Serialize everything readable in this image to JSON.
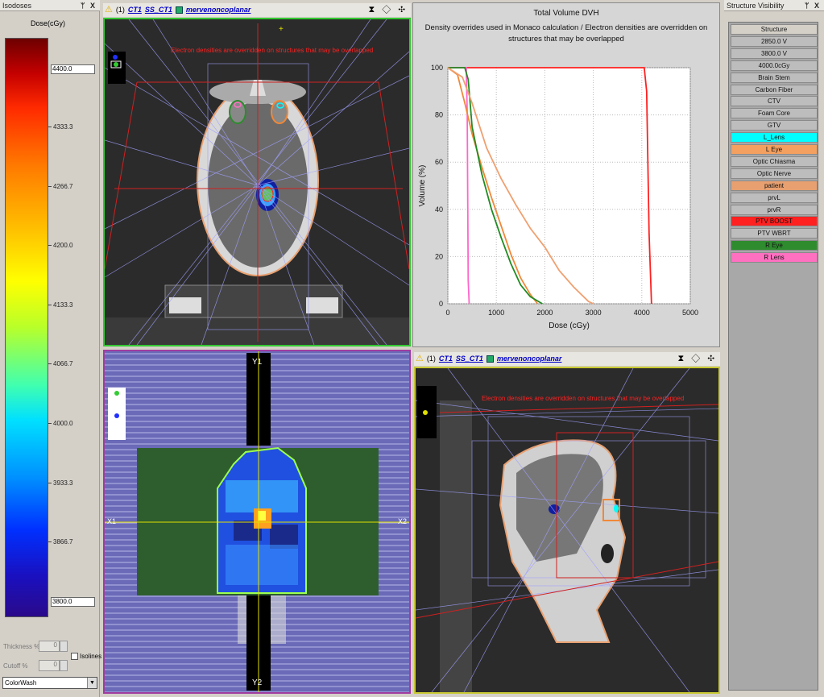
{
  "isodoses": {
    "title": "Isodoses",
    "pin": "ᛘ",
    "close": "X",
    "unit": "Dose(cGy)",
    "max_value": "4400.0",
    "min_value": "3800.0",
    "labels": [
      "4333.3",
      "4266.7",
      "4200.0",
      "4133.3",
      "4066.7",
      "4000.0",
      "3933.3",
      "3866.7"
    ],
    "thickness_label": "Thickness %",
    "thickness_value": "0",
    "cutoff_label": "Cutoff %",
    "cutoff_value": "0",
    "isolines_label": "Isolines",
    "render_mode": "ColorWash"
  },
  "toolbar": {
    "count": "(1)",
    "image_set": "CT1",
    "ss_set": "SS_CT1",
    "plan": "mervenoncoplanar",
    "controls": "⧗ ◇ ✣"
  },
  "views": {
    "warning_axial": "Electron densities are overridden on structures that may be overlapped",
    "warning_sagittal": "Electron densities are overridden on structures that may be overlapped",
    "bev_labels": {
      "y1": "Y1",
      "y2": "Y2",
      "x1": "X1",
      "x2": "X2"
    }
  },
  "dvh": {
    "title": "Total Volume DVH",
    "subtitle": "Density overrides used in Monaco calculation / Electron densities are overridden on structures that may be overlapped"
  },
  "chart_data": {
    "type": "line",
    "title": "Total Volume DVH",
    "xlabel": "Dose (cGy)",
    "ylabel": "Volume (%)",
    "xlim": [
      0,
      5000
    ],
    "ylim": [
      0,
      100
    ],
    "xticks": [
      "0",
      "1000",
      "2000",
      "3000",
      "4000",
      "5000"
    ],
    "yticks": [
      "0",
      "20",
      "40",
      "60",
      "80",
      "100"
    ],
    "grid": true,
    "series": [
      {
        "color": "#ff2020",
        "x": [
          0,
          420,
          440,
          4050,
          4100,
          4150,
          4200
        ],
        "y": [
          100,
          100,
          100,
          100,
          90,
          30,
          0
        ]
      },
      {
        "color": "#ff66cc",
        "x": [
          0,
          380,
          400,
          420,
          440
        ],
        "y": [
          100,
          100,
          80,
          10,
          0
        ]
      },
      {
        "color": "#f08838",
        "x": [
          0,
          200,
          350,
          500,
          700,
          900,
          1100,
          1300,
          1500,
          1700,
          1850
        ],
        "y": [
          100,
          97,
          85,
          72,
          58,
          45,
          33,
          21,
          11,
          4,
          0
        ]
      },
      {
        "color": "#228b22",
        "x": [
          0,
          350,
          420,
          500,
          700,
          900,
          1100,
          1300,
          1500,
          1700,
          1950
        ],
        "y": [
          100,
          100,
          95,
          75,
          55,
          40,
          28,
          17,
          8,
          3,
          0
        ]
      },
      {
        "color": "#f0a070",
        "x": [
          0,
          300,
          500,
          800,
          1100,
          1400,
          1700,
          2000,
          2300,
          2600,
          2900,
          3000
        ],
        "y": [
          100,
          96,
          85,
          66,
          53,
          42,
          32,
          24,
          14,
          7,
          1,
          0
        ]
      }
    ]
  },
  "structures": {
    "title": "Structure Visibility",
    "pin": "ᛘ",
    "close": "X",
    "items": [
      {
        "label": "Structure",
        "color": "#d4d0c8"
      },
      {
        "label": "2850.0 V",
        "color": "#bdbdbd"
      },
      {
        "label": "3800.0 V",
        "color": "#bdbdbd"
      },
      {
        "label": "4000.0cGy",
        "color": "#bdbdbd"
      },
      {
        "label": "Brain Stem",
        "color": "#bdbdbd"
      },
      {
        "label": "Carbon Fiber",
        "color": "#bdbdbd"
      },
      {
        "label": "CTV",
        "color": "#bdbdbd"
      },
      {
        "label": "Foam Core",
        "color": "#bdbdbd"
      },
      {
        "label": "GTV",
        "color": "#bdbdbd"
      },
      {
        "label": "L_Lens",
        "color": "#00ffff"
      },
      {
        "label": "L Eye",
        "color": "#f4a060"
      },
      {
        "label": "Optic Chiasma",
        "color": "#bdbdbd"
      },
      {
        "label": "Optic Nerve",
        "color": "#bdbdbd"
      },
      {
        "label": "patient",
        "color": "#e8a070"
      },
      {
        "label": "prvL",
        "color": "#bdbdbd"
      },
      {
        "label": "prvR",
        "color": "#bdbdbd"
      },
      {
        "label": "PTV BOOST",
        "color": "#ff2020"
      },
      {
        "label": "PTV WBRT",
        "color": "#bdbdbd"
      },
      {
        "label": "R Eye",
        "color": "#2e8b2e"
      },
      {
        "label": "R Lens",
        "color": "#ff70c0"
      }
    ]
  }
}
